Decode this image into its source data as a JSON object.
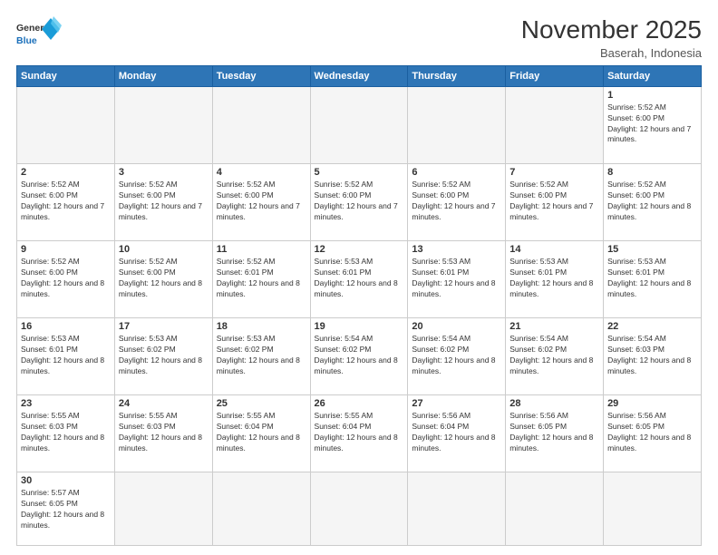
{
  "header": {
    "logo_general": "General",
    "logo_blue": "Blue",
    "month_title": "November 2025",
    "location": "Baserah, Indonesia"
  },
  "days_of_week": [
    "Sunday",
    "Monday",
    "Tuesday",
    "Wednesday",
    "Thursday",
    "Friday",
    "Saturday"
  ],
  "weeks": [
    [
      {
        "day": "",
        "empty": true
      },
      {
        "day": "",
        "empty": true
      },
      {
        "day": "",
        "empty": true
      },
      {
        "day": "",
        "empty": true
      },
      {
        "day": "",
        "empty": true
      },
      {
        "day": "",
        "empty": true
      },
      {
        "day": "1",
        "sunrise": "5:52 AM",
        "sunset": "6:00 PM",
        "daylight": "12 hours and 7 minutes."
      }
    ],
    [
      {
        "day": "2",
        "sunrise": "5:52 AM",
        "sunset": "6:00 PM",
        "daylight": "12 hours and 7 minutes."
      },
      {
        "day": "3",
        "sunrise": "5:52 AM",
        "sunset": "6:00 PM",
        "daylight": "12 hours and 7 minutes."
      },
      {
        "day": "4",
        "sunrise": "5:52 AM",
        "sunset": "6:00 PM",
        "daylight": "12 hours and 7 minutes."
      },
      {
        "day": "5",
        "sunrise": "5:52 AM",
        "sunset": "6:00 PM",
        "daylight": "12 hours and 7 minutes."
      },
      {
        "day": "6",
        "sunrise": "5:52 AM",
        "sunset": "6:00 PM",
        "daylight": "12 hours and 7 minutes."
      },
      {
        "day": "7",
        "sunrise": "5:52 AM",
        "sunset": "6:00 PM",
        "daylight": "12 hours and 7 minutes."
      },
      {
        "day": "8",
        "sunrise": "5:52 AM",
        "sunset": "6:00 PM",
        "daylight": "12 hours and 8 minutes."
      }
    ],
    [
      {
        "day": "9",
        "sunrise": "5:52 AM",
        "sunset": "6:00 PM",
        "daylight": "12 hours and 8 minutes."
      },
      {
        "day": "10",
        "sunrise": "5:52 AM",
        "sunset": "6:00 PM",
        "daylight": "12 hours and 8 minutes."
      },
      {
        "day": "11",
        "sunrise": "5:52 AM",
        "sunset": "6:01 PM",
        "daylight": "12 hours and 8 minutes."
      },
      {
        "day": "12",
        "sunrise": "5:53 AM",
        "sunset": "6:01 PM",
        "daylight": "12 hours and 8 minutes."
      },
      {
        "day": "13",
        "sunrise": "5:53 AM",
        "sunset": "6:01 PM",
        "daylight": "12 hours and 8 minutes."
      },
      {
        "day": "14",
        "sunrise": "5:53 AM",
        "sunset": "6:01 PM",
        "daylight": "12 hours and 8 minutes."
      },
      {
        "day": "15",
        "sunrise": "5:53 AM",
        "sunset": "6:01 PM",
        "daylight": "12 hours and 8 minutes."
      }
    ],
    [
      {
        "day": "16",
        "sunrise": "5:53 AM",
        "sunset": "6:01 PM",
        "daylight": "12 hours and 8 minutes."
      },
      {
        "day": "17",
        "sunrise": "5:53 AM",
        "sunset": "6:02 PM",
        "daylight": "12 hours and 8 minutes."
      },
      {
        "day": "18",
        "sunrise": "5:53 AM",
        "sunset": "6:02 PM",
        "daylight": "12 hours and 8 minutes."
      },
      {
        "day": "19",
        "sunrise": "5:54 AM",
        "sunset": "6:02 PM",
        "daylight": "12 hours and 8 minutes."
      },
      {
        "day": "20",
        "sunrise": "5:54 AM",
        "sunset": "6:02 PM",
        "daylight": "12 hours and 8 minutes."
      },
      {
        "day": "21",
        "sunrise": "5:54 AM",
        "sunset": "6:02 PM",
        "daylight": "12 hours and 8 minutes."
      },
      {
        "day": "22",
        "sunrise": "5:54 AM",
        "sunset": "6:03 PM",
        "daylight": "12 hours and 8 minutes."
      }
    ],
    [
      {
        "day": "23",
        "sunrise": "5:55 AM",
        "sunset": "6:03 PM",
        "daylight": "12 hours and 8 minutes."
      },
      {
        "day": "24",
        "sunrise": "5:55 AM",
        "sunset": "6:03 PM",
        "daylight": "12 hours and 8 minutes."
      },
      {
        "day": "25",
        "sunrise": "5:55 AM",
        "sunset": "6:04 PM",
        "daylight": "12 hours and 8 minutes."
      },
      {
        "day": "26",
        "sunrise": "5:55 AM",
        "sunset": "6:04 PM",
        "daylight": "12 hours and 8 minutes."
      },
      {
        "day": "27",
        "sunrise": "5:56 AM",
        "sunset": "6:04 PM",
        "daylight": "12 hours and 8 minutes."
      },
      {
        "day": "28",
        "sunrise": "5:56 AM",
        "sunset": "6:05 PM",
        "daylight": "12 hours and 8 minutes."
      },
      {
        "day": "29",
        "sunrise": "5:56 AM",
        "sunset": "6:05 PM",
        "daylight": "12 hours and 8 minutes."
      }
    ],
    [
      {
        "day": "30",
        "sunrise": "5:57 AM",
        "sunset": "6:05 PM",
        "daylight": "12 hours and 8 minutes.",
        "last": true
      },
      {
        "day": "",
        "empty": true,
        "last": true
      },
      {
        "day": "",
        "empty": true,
        "last": true
      },
      {
        "day": "",
        "empty": true,
        "last": true
      },
      {
        "day": "",
        "empty": true,
        "last": true
      },
      {
        "day": "",
        "empty": true,
        "last": true
      },
      {
        "day": "",
        "empty": true,
        "last": true
      }
    ]
  ]
}
